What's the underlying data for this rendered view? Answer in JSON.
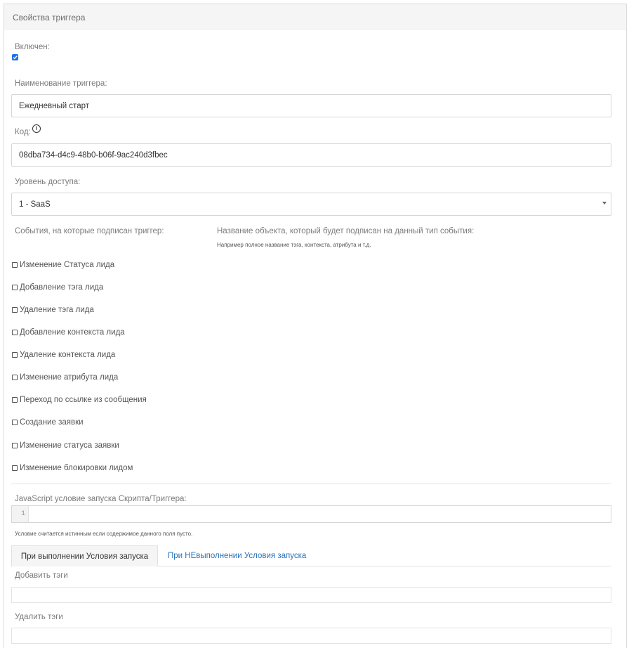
{
  "panel": {
    "title": "Свойства триггера"
  },
  "enabled": {
    "label": "Включен:",
    "checked": true
  },
  "trigger_name": {
    "label": "Наименование триггера:",
    "value": "Ежедневный старт"
  },
  "code": {
    "label": "Код:",
    "info_icon": "i",
    "value": "08dba734-d4c9-48b0-b06f-9ac240d3fbec"
  },
  "access_level": {
    "label": "Уровень доступа:",
    "selected": "1 - SaaS"
  },
  "events": {
    "label": "События, на которые подписан триггер:",
    "object_label": "Название объекта, который будет подписан на данный тип события:",
    "object_hint": "Например полное название тэга, контекста, атрибута и т.д.",
    "items": [
      {
        "label": "Изменение Статуса лида",
        "checked": false
      },
      {
        "label": "Добавление тэга лида",
        "checked": false
      },
      {
        "label": "Удаление тэга лида",
        "checked": false
      },
      {
        "label": "Добавление контекста лида",
        "checked": false
      },
      {
        "label": "Удаление контекста лида",
        "checked": false
      },
      {
        "label": "Изменение атрибута лида",
        "checked": false
      },
      {
        "label": "Переход по ссылке из сообщения",
        "checked": false
      },
      {
        "label": "Создание заявки",
        "checked": false
      },
      {
        "label": "Изменение статуса заявки",
        "checked": false
      },
      {
        "label": "Изменение блокировки лидом",
        "checked": false
      }
    ]
  },
  "js_condition": {
    "label": "JavaScript условие запуска Скрипта/Триггера:",
    "line_number": "1",
    "hint": "Условие считается истинным если содержимое данного поля пусто."
  },
  "tabs": [
    {
      "label": "При выполнении Условия запуска",
      "active": true
    },
    {
      "label": "При НЕвыполнении Условия запуска",
      "active": false
    }
  ],
  "add_tags": {
    "label": "Добавить тэги",
    "value": ""
  },
  "remove_tags": {
    "label": "Удалить тэги",
    "value": ""
  },
  "colors": {
    "accent": "#1a73e8",
    "link": "#2b73b7",
    "header_bg": "#f5f5f5"
  }
}
